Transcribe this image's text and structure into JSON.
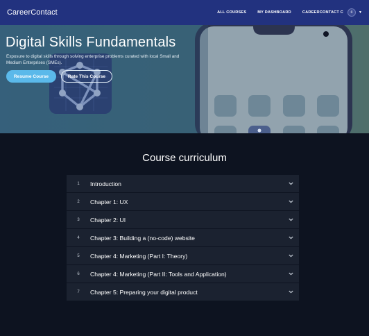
{
  "navbar": {
    "brand": "CareerContact",
    "links": [
      "ALL COURSES",
      "MY DASHBOARD",
      "CAREERCONTACT C"
    ],
    "avatar_letter": "c",
    "colors": {
      "background": "#22327f"
    }
  },
  "hero": {
    "title": "Digital Skills Fundamentals",
    "description": "Exposure to digital skills through solving enterprise problems curated with local Small and Medium Enterprises (SMEs).",
    "resume_label": "Resume Course",
    "rate_label": "Rate This Course",
    "colors": {
      "resume_button": "#5bb9ea"
    }
  },
  "curriculum": {
    "title": "Course curriculum",
    "items": [
      {
        "num": "1",
        "title": "Introduction"
      },
      {
        "num": "2",
        "title": "Chapter 1: UX"
      },
      {
        "num": "3",
        "title": "Chapter 2: UI"
      },
      {
        "num": "4",
        "title": "Chapter 3: Building a (no-code) website"
      },
      {
        "num": "5",
        "title": "Chapter 4: Marketing (Part I: Theory)"
      },
      {
        "num": "6",
        "title": "Chapter 4: Marketing (Part II: Tools and Application)"
      },
      {
        "num": "7",
        "title": "Chapter 5: Preparing your digital product"
      }
    ],
    "icon": "chevron-down-icon"
  }
}
